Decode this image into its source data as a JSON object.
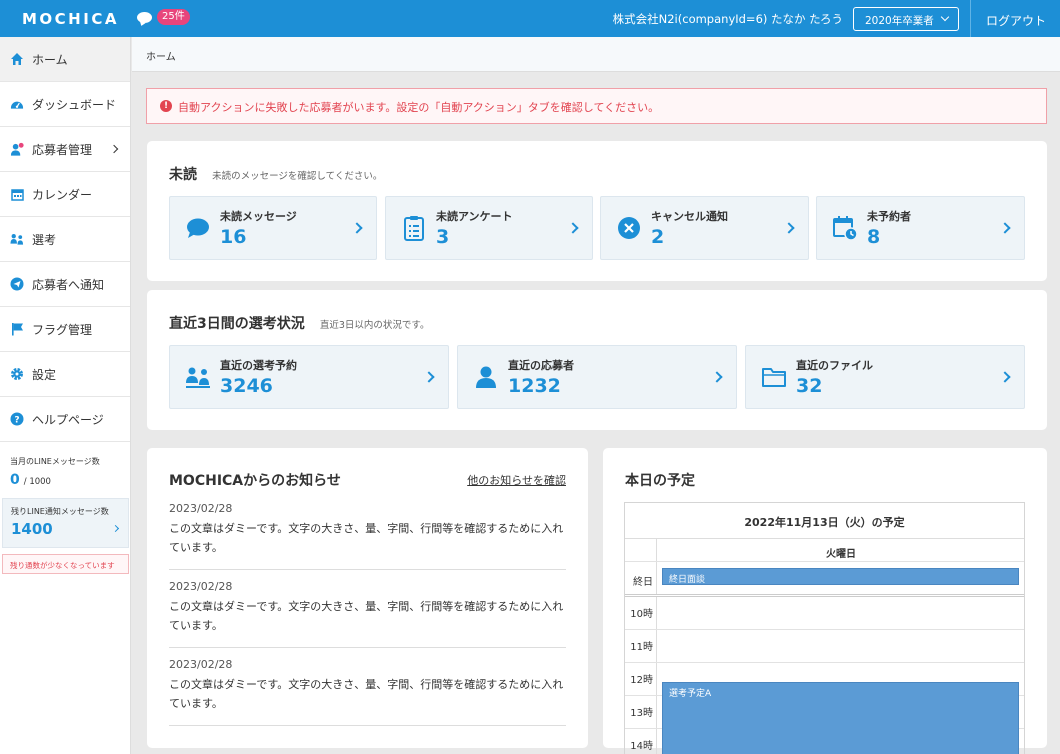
{
  "header": {
    "logo": "MOCHICA",
    "message_count": "25件",
    "company": "株式会社N2i(companyId=6) たなか たろう",
    "year_select": "2020年卒業者",
    "logout": "ログアウト"
  },
  "sidebar": {
    "items": [
      {
        "label": "ホーム",
        "icon": "home-icon"
      },
      {
        "label": "ダッシュボード",
        "icon": "dashboard-icon"
      },
      {
        "label": "応募者管理",
        "icon": "applicant-icon"
      },
      {
        "label": "カレンダー",
        "icon": "calendar-icon"
      },
      {
        "label": "選考",
        "icon": "selection-icon"
      },
      {
        "label": "応募者へ通知",
        "icon": "send-icon"
      },
      {
        "label": "フラグ管理",
        "icon": "flag-icon"
      },
      {
        "label": "設定",
        "icon": "gear-icon"
      },
      {
        "label": "ヘルプページ",
        "icon": "help-icon"
      }
    ],
    "line_label": "当月のLINEメッセージ数",
    "line_value": "0",
    "line_total": "/ 1000",
    "remain_label": "残りLINE通知メッセージ数",
    "remain_value": "1400",
    "remain_warning": "残り通数が少なくなっています"
  },
  "breadcrumb": "ホーム",
  "alert": "自動アクションに失敗した応募者がいます。設定の「自動アクション」タブを確認してください。",
  "unread": {
    "title": "未読",
    "subtitle": "未読のメッセージを確認してください。",
    "stats": [
      {
        "label": "未読メッセージ",
        "value": "16",
        "icon": "chat-icon"
      },
      {
        "label": "未読アンケート",
        "value": "3",
        "icon": "survey-icon"
      },
      {
        "label": "キャンセル通知",
        "value": "2",
        "icon": "cancel-icon"
      },
      {
        "label": "未予約者",
        "value": "8",
        "icon": "calendar-clock-icon"
      }
    ]
  },
  "recent": {
    "title": "直近3日間の選考状況",
    "subtitle": "直近3日以内の状況です。",
    "stats": [
      {
        "label": "直近の選考予約",
        "value": "3246",
        "icon": "selection-icon"
      },
      {
        "label": "直近の応募者",
        "value": "1232",
        "icon": "person-icon"
      },
      {
        "label": "直近のファイル",
        "value": "32",
        "icon": "folder-icon"
      }
    ]
  },
  "news": {
    "title": "MOCHICAからのお知らせ",
    "link": "他のお知らせを確認",
    "items": [
      {
        "date": "2023/02/28",
        "text": "この文章はダミーです。文字の大きさ、量、字間、行間等を確認するために入れています。"
      },
      {
        "date": "2023/02/28",
        "text": "この文章はダミーです。文字の大きさ、量、字間、行間等を確認するために入れています。"
      },
      {
        "date": "2023/02/28",
        "text": "この文章はダミーです。文字の大きさ、量、字間、行間等を確認するために入れています。"
      }
    ]
  },
  "schedule": {
    "title": "本日の予定",
    "date": "2022年11月13日（火）の予定",
    "day": "火曜日",
    "allday_label": "終日",
    "allday_event": "終日面談",
    "hours": [
      "10時",
      "11時",
      "12時",
      "13時",
      "14時"
    ],
    "event": "選考予定A"
  },
  "colors": {
    "accent": "#1d8fd6",
    "alert": "#e24450",
    "badge": "#e8457c",
    "event": "#5b9bd5"
  }
}
